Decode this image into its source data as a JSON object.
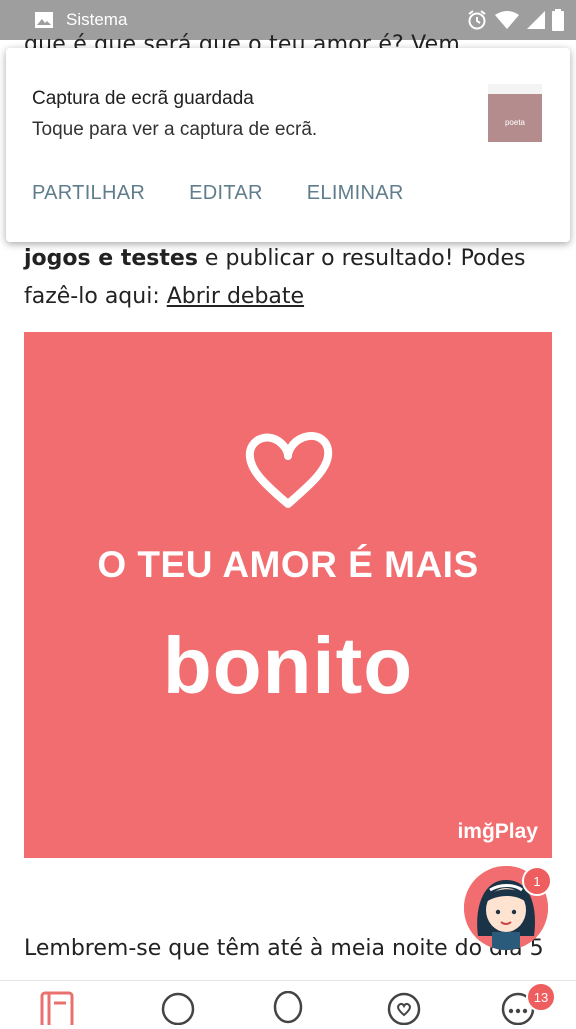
{
  "status_bar": {
    "app_name": "Sistema",
    "icons": [
      "image-icon",
      "alarm-icon",
      "wifi-icon",
      "signal-icon",
      "battery-icon"
    ]
  },
  "article": {
    "partial_top_line": "que é que será que o teu amor é? Vem",
    "para1_bold": "jogos e testes",
    "para1_text": " e publicar o resultado! Podes fazê-lo aqui: ",
    "para1_link": "Abrir debate",
    "hero": {
      "line1": "O TEU AMOR É MAIS",
      "line2": "bonito",
      "watermark": "imğPlay",
      "background": "#f26d6f"
    },
    "para2_text": "Lembrem-se que têm até à meia noite do dia 5"
  },
  "notification": {
    "title": "Captura de ecrã guardada",
    "subtitle": "Toque para ver a captura de ecrã.",
    "thumb_text": "poeta",
    "actions": [
      "PARTILHAR",
      "EDITAR",
      "ELIMINAR"
    ]
  },
  "floating_avatar": {
    "badge": "1"
  },
  "bottom_nav": {
    "items": [
      "notebook-icon",
      "chat-bubble-icon",
      "balloon-icon",
      "heart-chat-icon",
      "more-icon"
    ],
    "more_badge": "13",
    "accent": "#e8706f"
  }
}
